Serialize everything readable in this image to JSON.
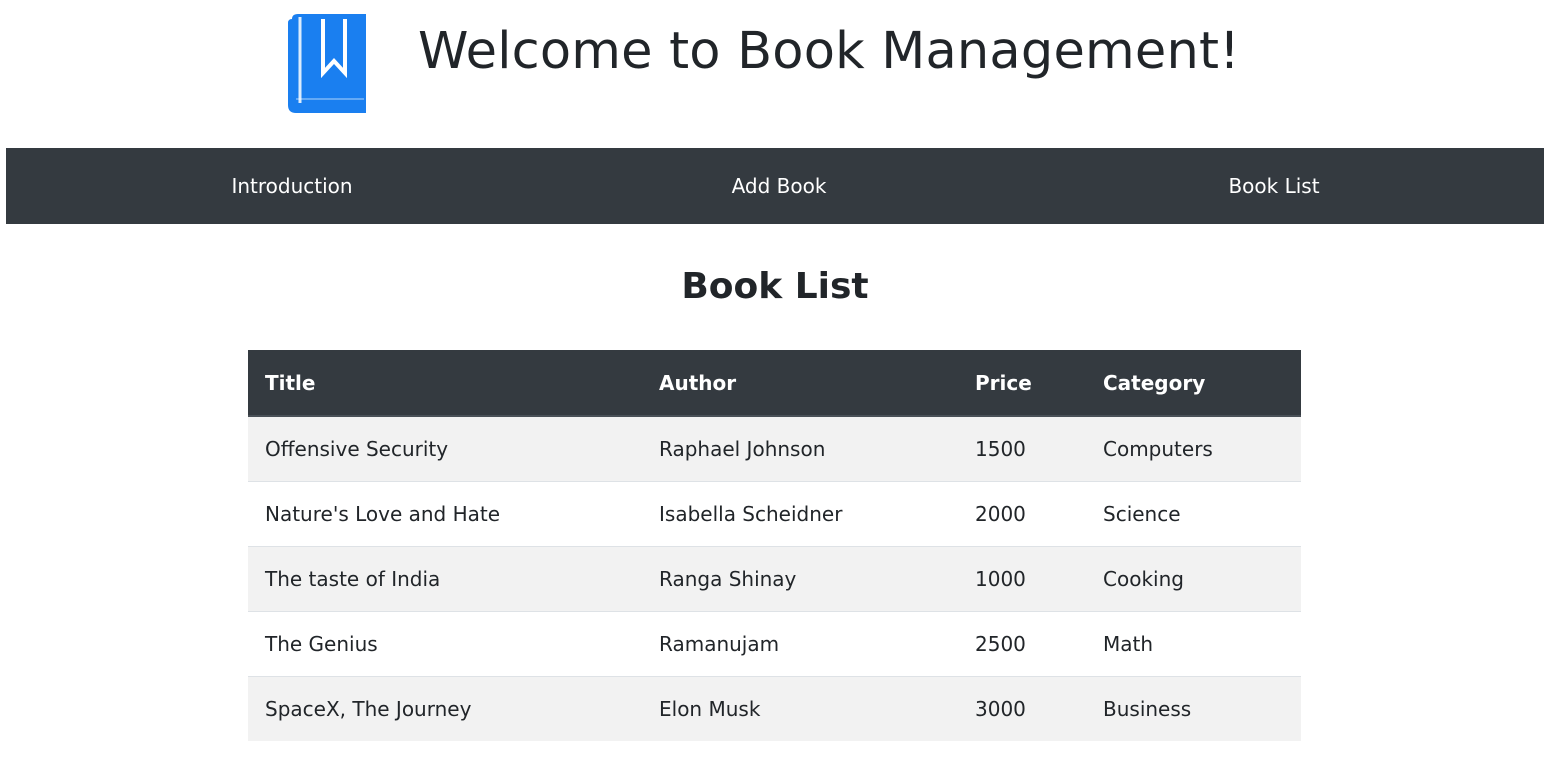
{
  "header": {
    "title": "Welcome to Book Management!",
    "logo_icon": "book-bookmark-icon",
    "logo_color": "#1a7ff0"
  },
  "nav": {
    "items": [
      {
        "label": "Introduction"
      },
      {
        "label": "Add Book"
      },
      {
        "label": "Book List"
      }
    ],
    "background": "#343a40"
  },
  "main": {
    "heading": "Book List",
    "table": {
      "columns": [
        "Title",
        "Author",
        "Price",
        "Category"
      ],
      "rows": [
        [
          "Offensive Security",
          "Raphael Johnson",
          "1500",
          "Computers"
        ],
        [
          "Nature's Love and Hate",
          "Isabella Scheidner",
          "2000",
          "Science"
        ],
        [
          "The taste of India",
          "Ranga Shinay",
          "1000",
          "Cooking"
        ],
        [
          "The Genius",
          "Ramanujam",
          "2500",
          "Math"
        ],
        [
          "SpaceX, The Journey",
          "Elon Musk",
          "3000",
          "Business"
        ]
      ]
    }
  }
}
